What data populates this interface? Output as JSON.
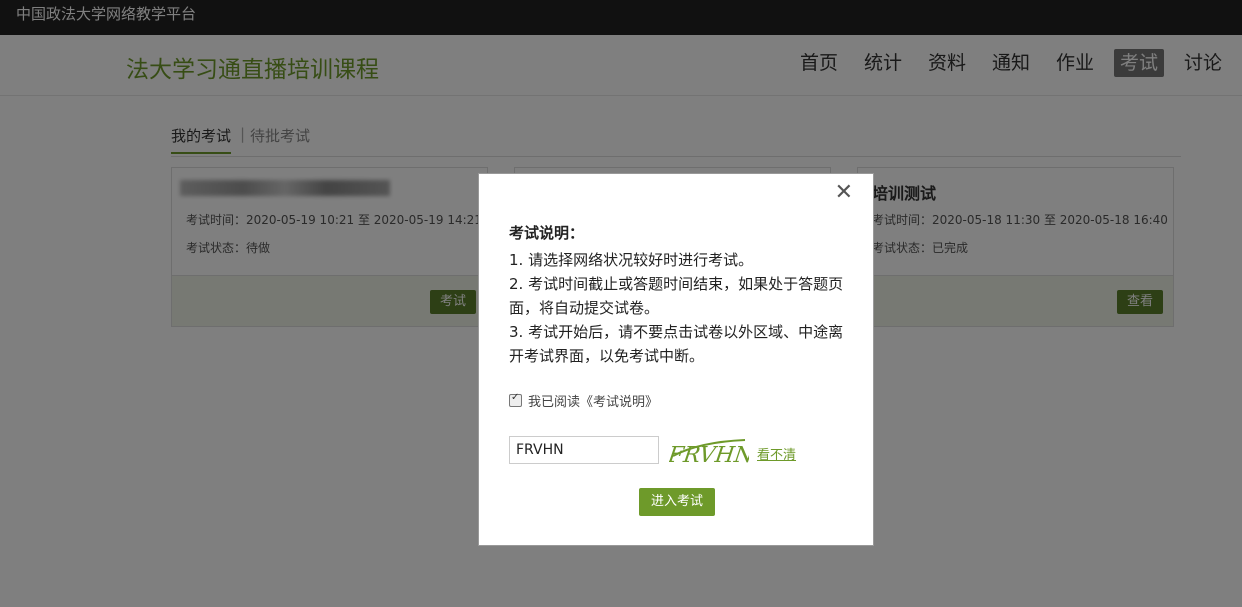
{
  "topbar": {
    "platform_name": "中国政法大学网络教学平台"
  },
  "header": {
    "course_title": "法大学习通直播培训课程",
    "nav": [
      "首页",
      "统计",
      "资料",
      "通知",
      "作业",
      "考试",
      "讨论"
    ],
    "active_nav": "考试"
  },
  "tabs": {
    "my_exams": "我的考试",
    "separator": "|",
    "pending": "待批考试"
  },
  "cards": [
    {
      "name": "",
      "time": "考试时间：2020-05-19 10:21 至 2020-05-19 14:21",
      "status": "考试状态：待做",
      "button": "考试"
    },
    {
      "name": "培训测试",
      "time": "考试时间：2020-05-18 11:30 至 2020-05-18 16:40",
      "status": "考试状态：已完成",
      "button": "查看"
    }
  ],
  "modal": {
    "close": "✕",
    "heading": "考试说明：",
    "rules": [
      "1. 请选择网络状况较好时进行考试。",
      "2. 考试时间截止或答题时间结束，如果处于答题页面，将自动提交试卷。",
      "3. 考试开始后，请不要点击试卷以外区域、中途离开考试界面，以免考试中断。"
    ],
    "agree_label": "我已阅读《考试说明》",
    "agree_checked": true,
    "captcha_value": "FRVHN",
    "captcha_text": "FRVHN",
    "refresh_label": "看不清",
    "enter_button": "进入考试"
  },
  "colors": {
    "accent": "#6e9a2a",
    "topbar": "#222222"
  }
}
